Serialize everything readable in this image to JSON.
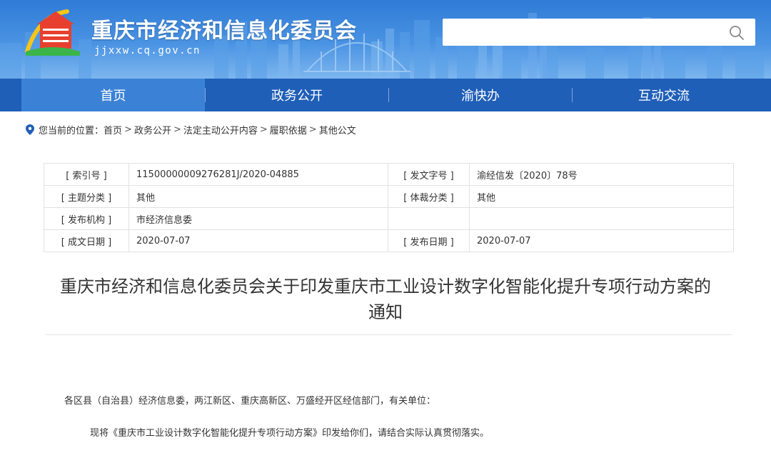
{
  "header": {
    "site_title": "重庆市经济和信息化委员会",
    "site_domain": "jjxxw.cq.gov.cn",
    "search": {
      "value": "",
      "placeholder": ""
    },
    "colors": {
      "banner": "#3a86dc",
      "nav": "#1f5fb8",
      "nav_active": "#3b82d6"
    }
  },
  "nav": {
    "items": [
      {
        "label": "首页",
        "active": true
      },
      {
        "label": "政务公开",
        "active": false
      },
      {
        "label": "渝快办",
        "active": false
      },
      {
        "label": "互动交流",
        "active": false
      }
    ]
  },
  "breadcrumb": {
    "prefix": "您当前的位置：",
    "items": [
      "首页",
      "政务公开",
      "法定主动公开内容",
      "履职依据",
      "其他公文"
    ],
    "separator": ">"
  },
  "meta": {
    "rows": [
      [
        {
          "key": "[ 索引号 ]",
          "value": "11500000009276281J/2020-04885"
        },
        {
          "key": "[ 发文字号 ]",
          "value": "渝经信发〔2020〕78号"
        }
      ],
      [
        {
          "key": "[ 主题分类 ]",
          "value": "其他"
        },
        {
          "key": "[ 体裁分类 ]",
          "value": "其他"
        }
      ],
      [
        {
          "key": "[ 发布机构 ]",
          "value": "市经济信息委"
        },
        {
          "key": "",
          "value": ""
        }
      ],
      [
        {
          "key": "[ 成文日期 ]",
          "value": "2020-07-07"
        },
        {
          "key": "[ 发布日期 ]",
          "value": "2020-07-07"
        }
      ]
    ]
  },
  "document": {
    "title_line1": "重庆市经济和信息化委员会关于印发重庆市工业设计数字化智能化提升专项行动方案的",
    "title_line2": "通知",
    "paragraphs": [
      "各区县（自治县）经济信息委，两江新区、重庆高新区、万盛经开区经信部门，有关单位：",
      "现将《重庆市工业设计数字化智能化提升专项行动方案》印发给你们，请结合实际认真贯彻落实。"
    ]
  }
}
